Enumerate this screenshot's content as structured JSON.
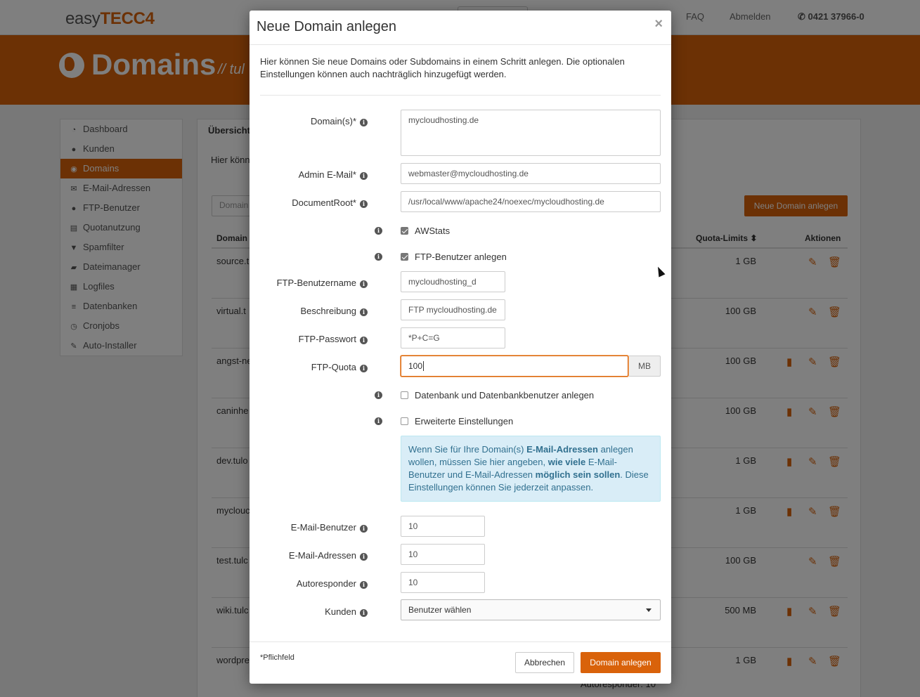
{
  "topbar": {
    "logo_prefix": "easy",
    "logo_brand": "TECC4",
    "nav_faq": "FAQ",
    "nav_logout": "Abmelden",
    "phone": "0421 37966-0"
  },
  "banner": {
    "title": "Domains",
    "subtitle": "// tul"
  },
  "sidebar": {
    "items": [
      {
        "label": "Dashboard",
        "icon": "dashboard-icon"
      },
      {
        "label": "Kunden",
        "icon": "users-icon"
      },
      {
        "label": "Domains",
        "icon": "globe-icon",
        "active": true
      },
      {
        "label": "E-Mail-Adressen",
        "icon": "envelope-icon"
      },
      {
        "label": "FTP-Benutzer",
        "icon": "user-icon"
      },
      {
        "label": "Quotanutzung",
        "icon": "hdd-icon"
      },
      {
        "label": "Spamfilter",
        "icon": "filter-icon"
      },
      {
        "label": "Dateimanager",
        "icon": "folder-icon"
      },
      {
        "label": "Logfiles",
        "icon": "calendar-icon"
      },
      {
        "label": "Datenbanken",
        "icon": "list-icon"
      },
      {
        "label": "Cronjobs",
        "icon": "clock-icon"
      },
      {
        "label": "Auto-Installer",
        "icon": "magic-icon"
      }
    ]
  },
  "panel": {
    "title": "Übersicht",
    "intro": "Hier könn",
    "filter_placeholder": "Domain",
    "new_button": "Neue Domain anlegen",
    "col_domain": "Domain",
    "col_quota": "Quota-Limits",
    "col_actions": "Aktionen",
    "rows": [
      {
        "domain": "source.t",
        "quota": "1 GB"
      },
      {
        "domain": "virtual.t",
        "quota": "100 GB"
      },
      {
        "domain": "angst-ne",
        "quota": "100 GB"
      },
      {
        "domain": "caninhe",
        "quota": "100 GB"
      },
      {
        "domain": "dev.tulo",
        "quota": "1 GB"
      },
      {
        "domain": "myclouc",
        "quota": "1 GB"
      },
      {
        "domain": "test.tulc",
        "quota": "100 GB"
      },
      {
        "domain": "wiki.tulc",
        "quota": "500 MB"
      },
      {
        "domain": "wordpre",
        "quota": "1 GB"
      }
    ],
    "bg_autoresponder": "Autoresponder: 10"
  },
  "modal": {
    "title": "Neue Domain anlegen",
    "close": "×",
    "intro": "Hier können Sie neue Domains oder Subdomains in einem Schritt anlegen. Die optionalen Einstellungen können auch nachträglich hinzugefügt werden.",
    "domains_label": "Domain(s)*",
    "domains_value": "mycloudhosting.de",
    "admin_email_label": "Admin E-Mail*",
    "admin_email_value": "webmaster@mycloudhosting.de",
    "docroot_label": "DocumentRoot*",
    "docroot_value": "/usr/local/www/apache24/noexec/mycloudhosting.de",
    "awstats_label": "AWStats",
    "ftp_create_label": "FTP-Benutzer anlegen",
    "ftp_user_label": "FTP-Benutzername",
    "ftp_user_value": "mycloudhosting_d",
    "desc_label": "Beschreibung",
    "desc_value": "FTP mycloudhosting.de",
    "ftp_pass_label": "FTP-Passwort",
    "ftp_pass_value": "*P+C=G",
    "ftp_quota_label": "FTP-Quota",
    "ftp_quota_value": "100",
    "ftp_quota_unit": "MB",
    "db_create_label": "Datenbank und Datenbankbenutzer anlegen",
    "advanced_label": "Erweiterte Einstellungen",
    "alert": {
      "p1": "Wenn Sie für Ihre Domain(s) ",
      "b1": "E-Mail-Adressen",
      "p2": " anlegen wollen, müssen Sie hier angeben, ",
      "b2": "wie viele",
      "p3": " E-Mail-Benutzer und E-Mail-Adressen ",
      "b3": "möglich sein sollen",
      "p4": ". Diese Einstellungen können Sie jederzeit anpassen."
    },
    "mail_users_label": "E-Mail-Benutzer",
    "mail_users_value": "10",
    "mail_addresses_label": "E-Mail-Adressen",
    "mail_addresses_value": "10",
    "autoresponder_label": "Autoresponder",
    "autoresponder_value": "10",
    "customer_label": "Kunden",
    "customer_value": "Benutzer wählen",
    "required_note": "*Pflichfeld",
    "cancel": "Abbrechen",
    "submit": "Domain anlegen"
  },
  "colors": {
    "accent": "#d9620a",
    "info_bg": "#d9edf7",
    "info_text": "#31708f"
  }
}
